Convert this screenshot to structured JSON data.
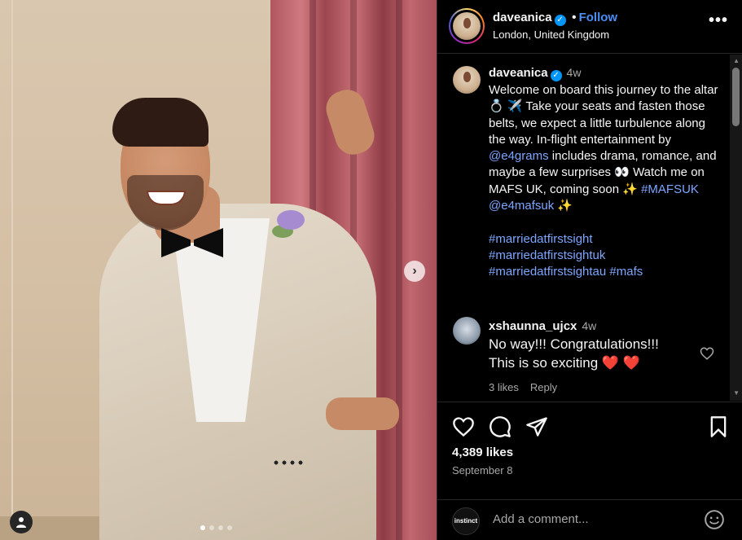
{
  "post": {
    "username": "daveanica",
    "follow_label": "Follow",
    "location": "London, United Kingdom",
    "more_label": "•••",
    "verified_mark": "✓",
    "carousel": {
      "next_label": "›",
      "slides": 4,
      "active": 0
    }
  },
  "caption": {
    "username": "daveanica",
    "time": "4w",
    "text_1": "Welcome on board this journey to the altar 💍 ✈️ Take your seats and fasten those belts, we expect a little turbulence along the way. In-flight entertainment by ",
    "mention_1": "@e4grams",
    "text_2": " includes drama, romance, and maybe a few surprises 👀 Watch me on MAFS UK, coming soon ✨ ",
    "hashtag_1": "#MAFSUK",
    "mention_2": "@e4mafsuk",
    "text_3": " ✨",
    "hashtags": [
      "#marriedatfirstsight",
      "#marriedatfirstsightuk",
      "#marriedatfirstsightau",
      "#mafs"
    ]
  },
  "comment": {
    "username": "xshaunna_ujcx",
    "time": "4w",
    "line_1": "No way!!! Congratulations!!!",
    "line_2": "This is so exciting ❤️ ❤️",
    "likes": "3 likes",
    "reply_label": "Reply"
  },
  "actions": {
    "likes": "4,389 likes",
    "date": "September 8"
  },
  "add_comment": {
    "avatar_label": "instinct",
    "placeholder": "Add a comment..."
  },
  "colors": {
    "link": "#7ea6ff",
    "follow": "#4a8ef6",
    "verified": "#0095f6",
    "background": "#000000"
  },
  "icons": [
    "heart-icon",
    "comment-icon",
    "share-icon",
    "bookmark-icon",
    "emoji-icon",
    "person-tag-icon",
    "chevron-right-icon",
    "more-icon"
  ]
}
